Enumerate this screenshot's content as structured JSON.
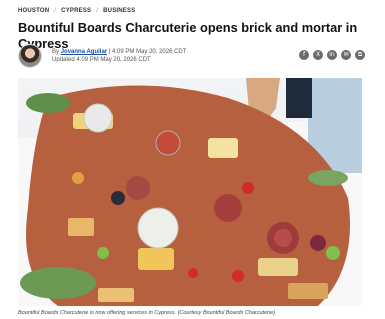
{
  "breadcrumb": {
    "items": [
      "HOUSTON",
      "CYPRESS",
      "BUSINESS"
    ],
    "separator": "/"
  },
  "article": {
    "headline": "Bountiful Boards Charcuterie opens brick and mortar in Cypress",
    "by_prefix": "By",
    "author": "Jovanna Aguilar",
    "published": "| 4:09 PM May 20, 2026 CDT",
    "updated": "Updated 4:09 PM May 20, 2026 CDT",
    "caption": "Bountiful Boards Charcuterie is now offering services in Cypress. (Courtesy Bountiful Boards Charcuterie)"
  },
  "share": {
    "icons": [
      {
        "name": "facebook-icon",
        "glyph": "f"
      },
      {
        "name": "x-icon",
        "glyph": "X"
      },
      {
        "name": "linkedin-icon",
        "glyph": "in"
      },
      {
        "name": "email-icon",
        "glyph": "✉"
      },
      {
        "name": "copy-link-icon",
        "glyph": "⧉"
      }
    ]
  }
}
